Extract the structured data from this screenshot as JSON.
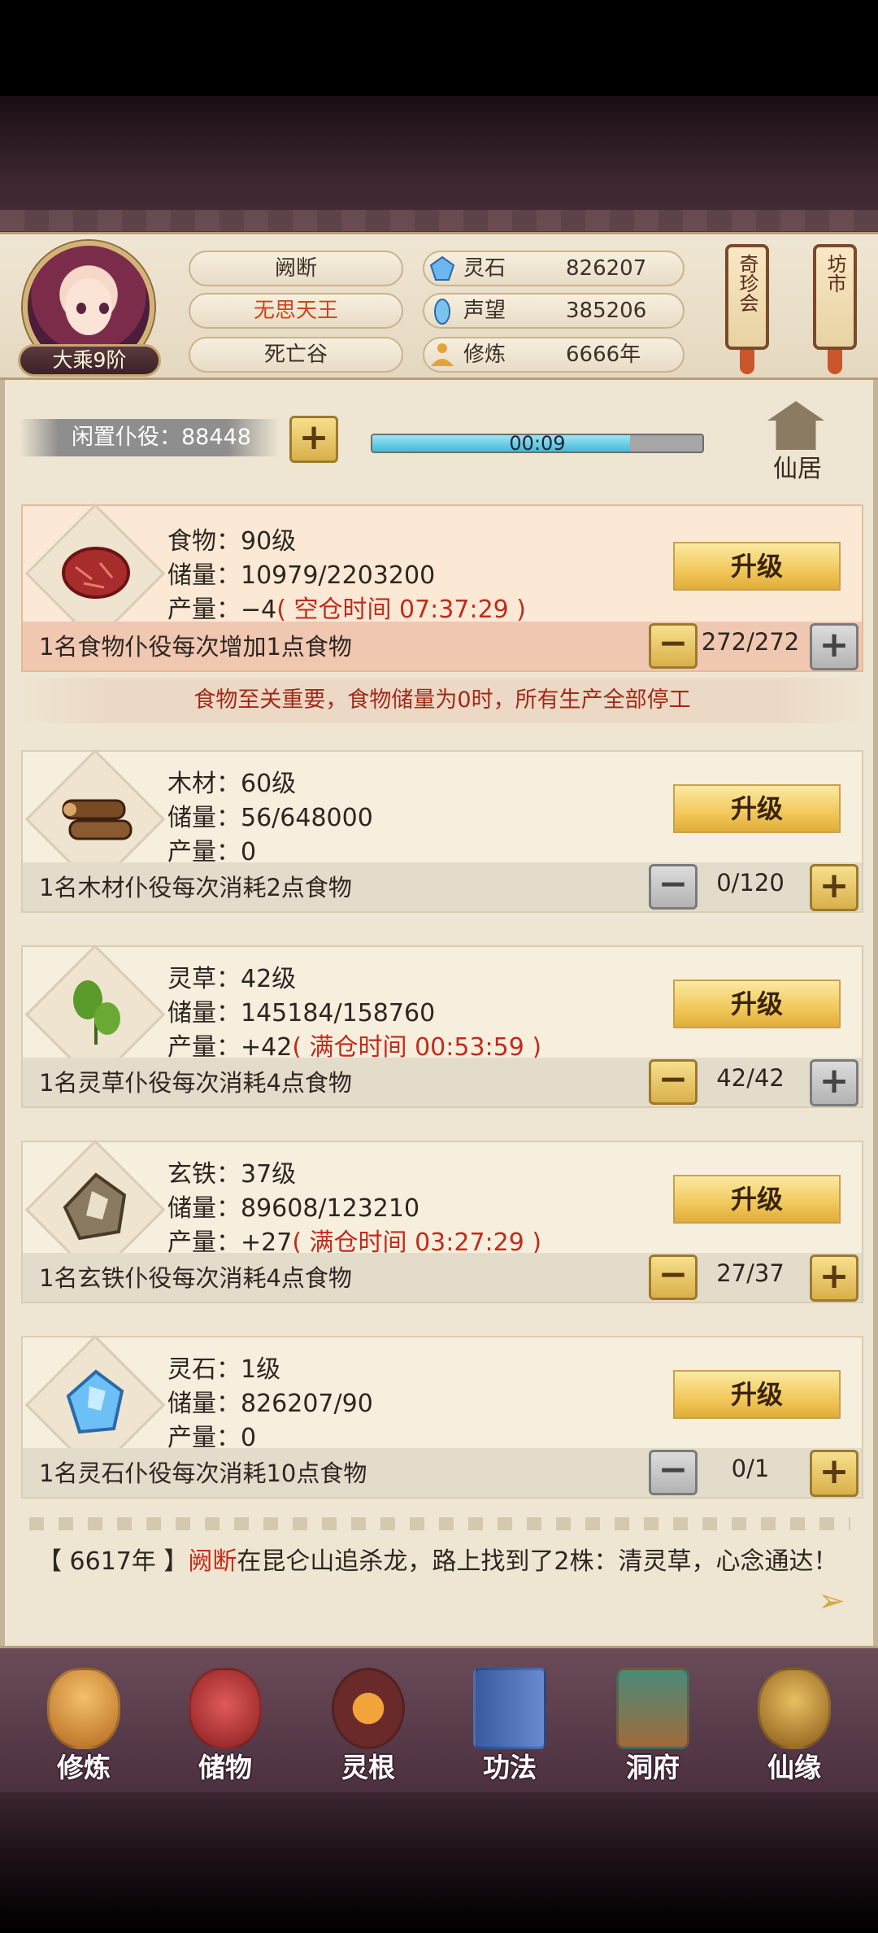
{
  "header": {
    "rank": "大乘9阶",
    "name": "阙断",
    "title": "无思天王",
    "location": "死亡谷",
    "resources": [
      {
        "label": "灵石",
        "value": "826207",
        "icon": "spirit-stone-icon"
      },
      {
        "label": "声望",
        "value": "385206",
        "icon": "prestige-icon"
      },
      {
        "label": "修炼",
        "value": "6666年",
        "icon": "meditation-icon"
      }
    ],
    "lanterns": [
      {
        "label": "奇珍会"
      },
      {
        "label": "坊市"
      }
    ]
  },
  "idle": {
    "label": "闲置仆役：88448",
    "progress_text": "00:09",
    "progress_fraction": 0.78,
    "building_label": "仙居"
  },
  "warning": "食物至关重要，食物储量为0时，所有生产全部停工",
  "resources": [
    {
      "key": "food",
      "level": "食物：90级",
      "storage": "储量：10979/2203200",
      "production_prefix": "产量：−4",
      "production_note": "( 空仓时间 07:37:29 )",
      "upgrade": "升级",
      "desc": "1名食物仆役每次增加1点食物",
      "count": "272/272"
    },
    {
      "key": "wood",
      "level": "木材：60级",
      "storage": "储量：56/648000",
      "production_prefix": "产量：0",
      "production_note": "",
      "upgrade": "升级",
      "desc": "1名木材仆役每次消耗2点食物",
      "count": "0/120"
    },
    {
      "key": "herb",
      "level": "灵草：42级",
      "storage": "储量：145184/158760",
      "production_prefix": "产量：+42",
      "production_note": "( 满仓时间 00:53:59 )",
      "upgrade": "升级",
      "desc": "1名灵草仆役每次消耗4点食物",
      "count": "42/42"
    },
    {
      "key": "iron",
      "level": "玄铁：37级",
      "storage": "储量：89608/123210",
      "production_prefix": "产量：+27",
      "production_note": "( 满仓时间 03:27:29 )",
      "upgrade": "升级",
      "desc": "1名玄铁仆役每次消耗4点食物",
      "count": "27/37"
    },
    {
      "key": "stone",
      "level": "灵石：1级",
      "storage": "储量：826207/90",
      "production_prefix": "产量：0",
      "production_note": "",
      "upgrade": "升级",
      "desc": "1名灵石仆役每次消耗10点食物",
      "count": "0/1"
    }
  ],
  "log": {
    "year": "【 6617年 】",
    "name": "阙断",
    "text": "在昆仑山追杀龙，路上找到了2株：清灵草，心念通达！"
  },
  "nav": [
    {
      "label": "修炼",
      "icon": "cultivate-icon"
    },
    {
      "label": "储物",
      "icon": "storage-bag-icon"
    },
    {
      "label": "灵根",
      "icon": "spirit-root-icon"
    },
    {
      "label": "功法",
      "icon": "technique-book-icon"
    },
    {
      "label": "洞府",
      "icon": "cave-dwelling-icon"
    },
    {
      "label": "仙缘",
      "icon": "fortune-icon"
    }
  ],
  "colors": {
    "accent_red": "#c22b1c",
    "button_gold": "#f1c85a",
    "progress_blue": "#45b8d8"
  }
}
